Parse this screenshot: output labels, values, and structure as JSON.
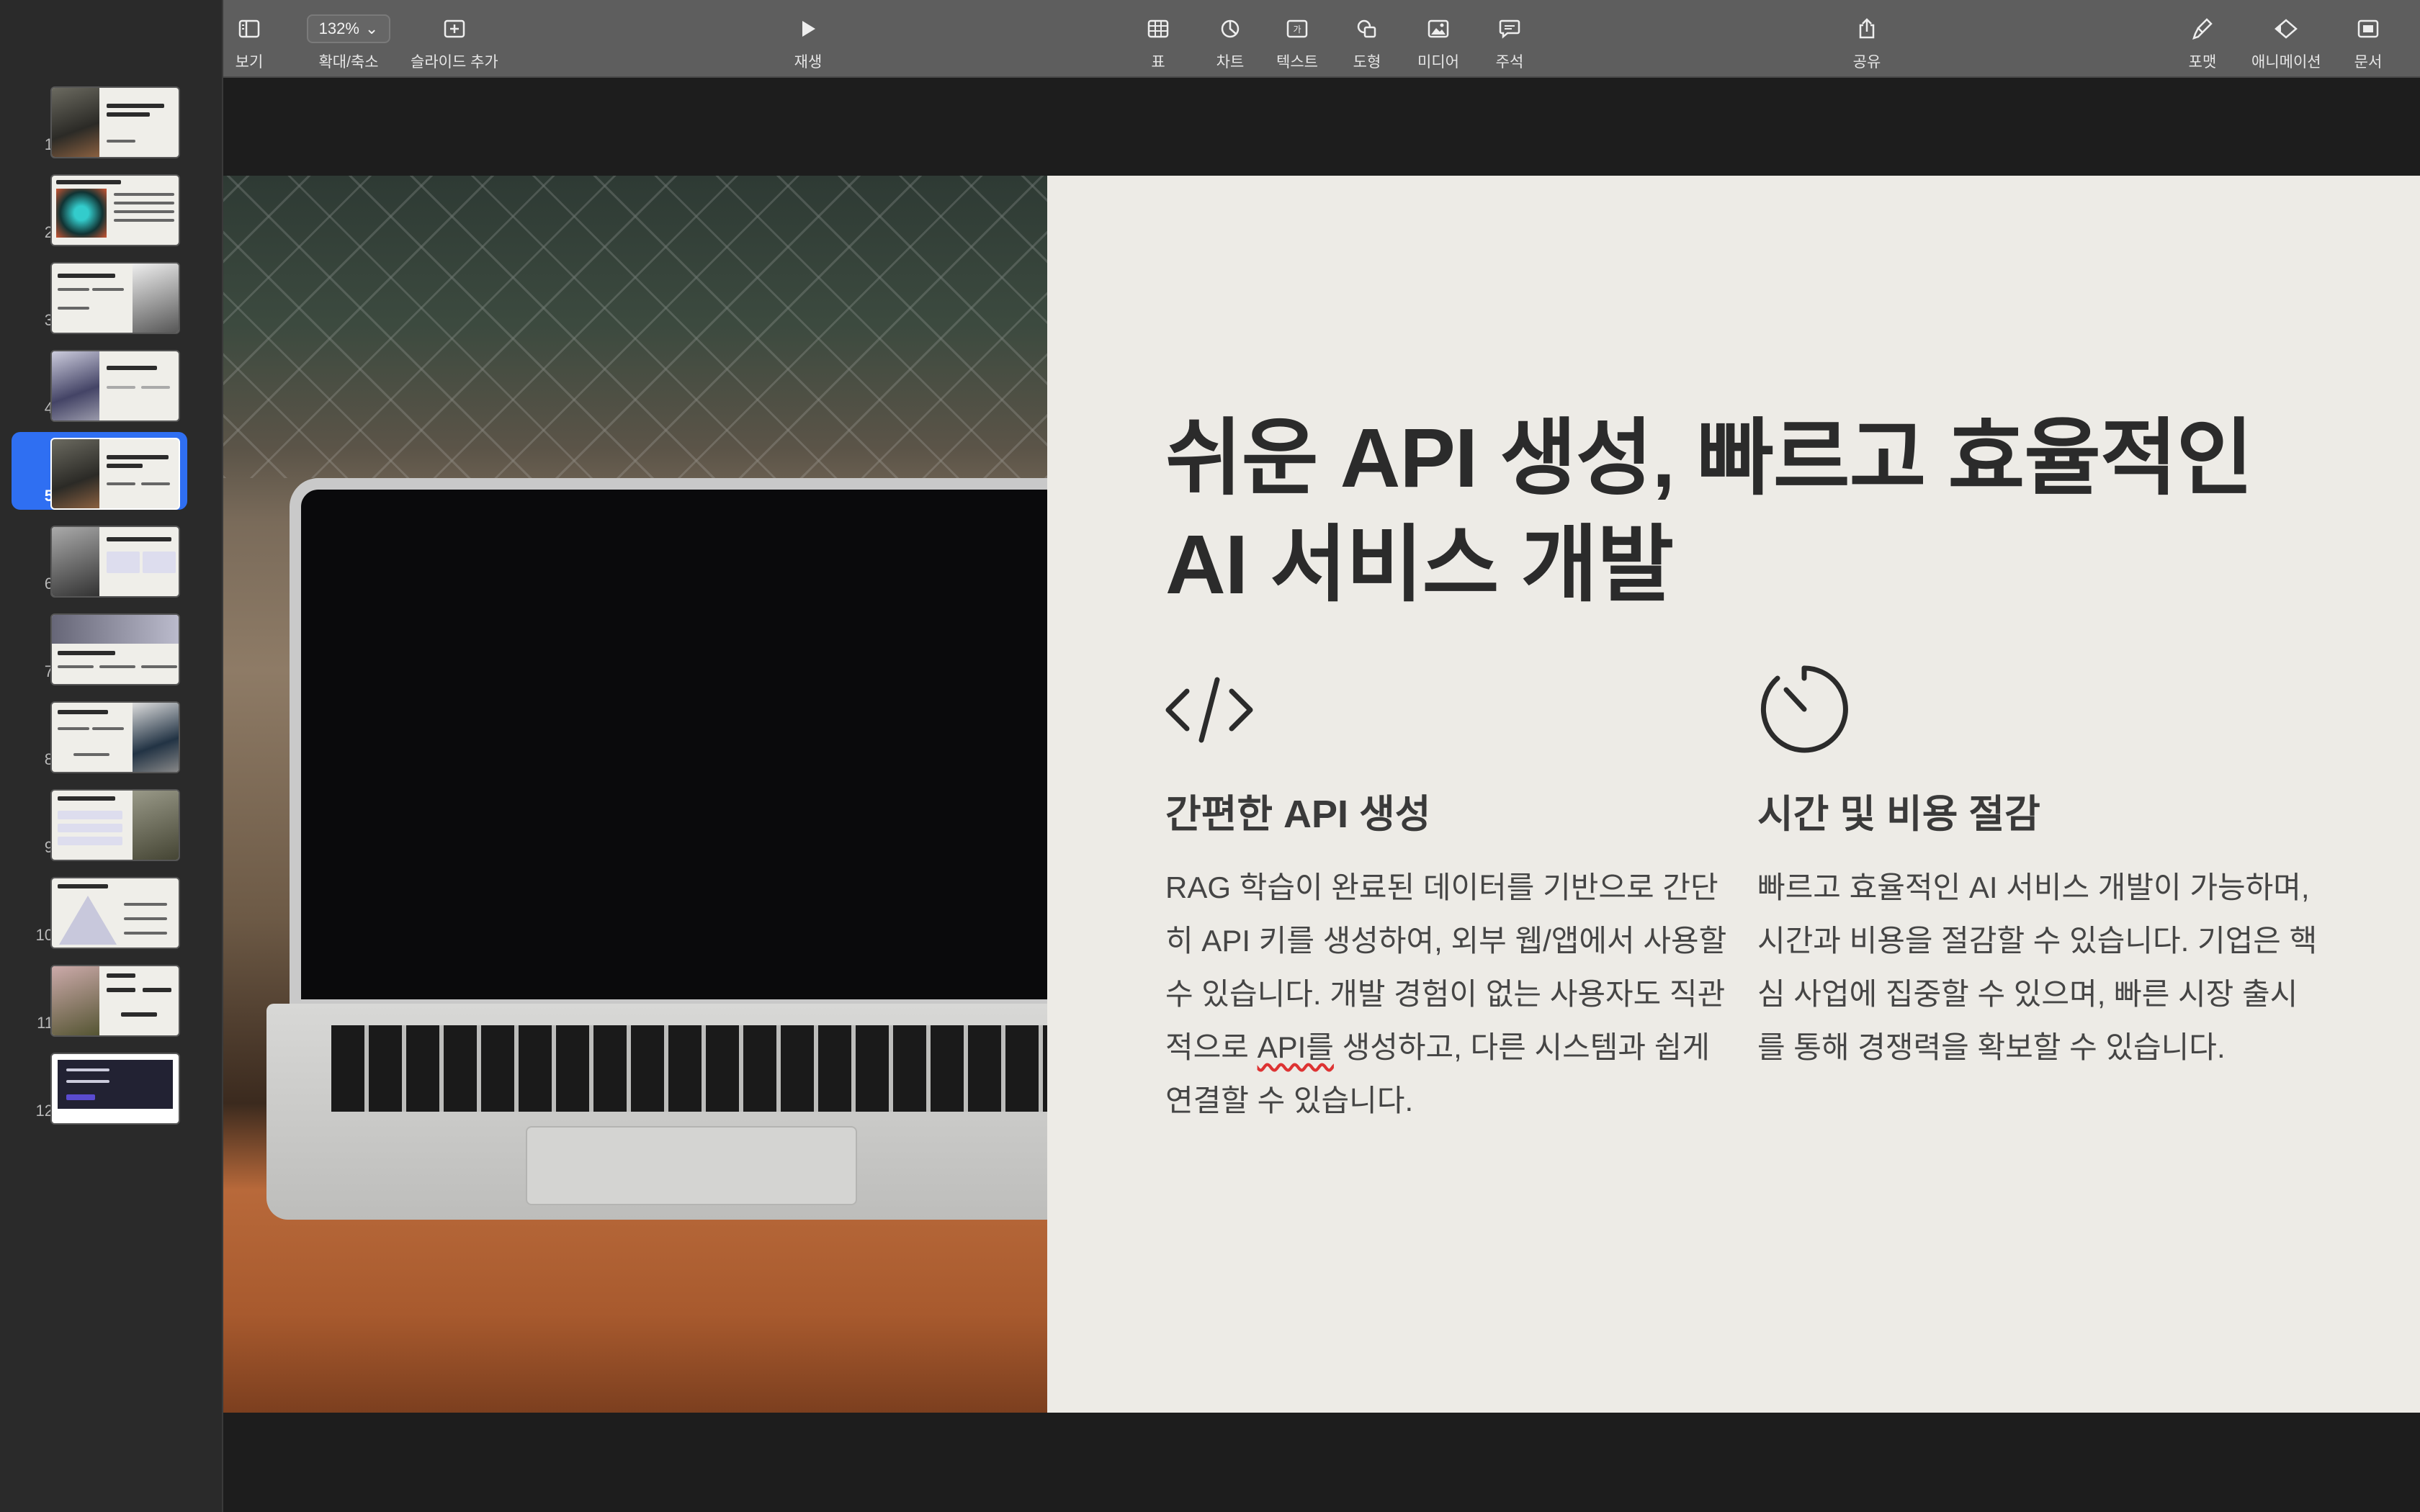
{
  "toolbar": {
    "view": "보기",
    "zoom_value": "132%",
    "zoom_label": "확대/축소",
    "add_slide": "슬라이드 추가",
    "play": "재생",
    "table": "표",
    "chart": "차트",
    "text": "텍스트",
    "shape": "도형",
    "media": "미디어",
    "comment": "주석",
    "share": "공유",
    "format": "포맷",
    "animate": "애니메이션",
    "document": "문서"
  },
  "sidebar": {
    "slides": [
      {
        "num": "1"
      },
      {
        "num": "2"
      },
      {
        "num": "3"
      },
      {
        "num": "4"
      },
      {
        "num": "5",
        "active": true
      },
      {
        "num": "6"
      },
      {
        "num": "7"
      },
      {
        "num": "8"
      },
      {
        "num": "9"
      },
      {
        "num": "10"
      },
      {
        "num": "11"
      },
      {
        "num": "12"
      }
    ]
  },
  "slide": {
    "headline_line1": "쉬운 API 생성, 빠르고 효율적인",
    "headline_line2": "AI 서비스 개발",
    "feature1": {
      "icon": "code-icon",
      "title": "간편한 API 생성",
      "body_pre": "RAG 학습이 완료된 데이터를 기반으로 간단히 API 키를 생성하여, 외부 웹/앱에서 사용할 수 있습니다. 개발 경험이 없는 사용자도 직관적으로 ",
      "body_mark": "API를",
      "body_post": " 생성하고, 다른 시스템과 쉽게 연결할 수 있습니다."
    },
    "feature2": {
      "icon": "timer-icon",
      "title": "시간 및 비용 절감",
      "body": "빠르고 효율적인 AI 서비스 개발이 가능하며, 시간과 비용을 절감할 수 있습니다. 기업은 핵심 사업에 집중할 수 있으며, 빠른 시장 출시를 통해 경쟁력을 확보할 수 있습니다."
    }
  },
  "colors": {
    "accent": "#2f6ff2",
    "slide_bg": "#edebe6",
    "toolbar_bg": "#5e5e5e"
  }
}
